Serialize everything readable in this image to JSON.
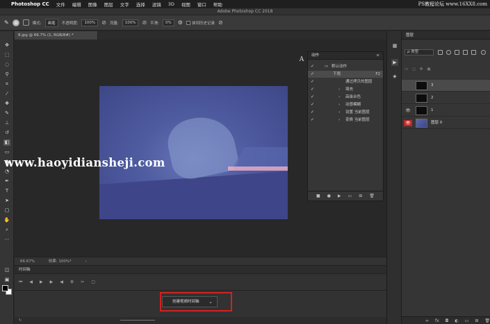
{
  "menubar": {
    "app_name": "Photoshop CC",
    "items": [
      "文件",
      "编辑",
      "图像",
      "图层",
      "文字",
      "选择",
      "滤镜",
      "3D",
      "视图",
      "窗口",
      "帮助"
    ],
    "watermark": "PS教程论坛 www.16XX8.com"
  },
  "window": {
    "title": "Adobe Photoshop CC 2018"
  },
  "options": {
    "mode_label": "模式:",
    "mode_value": "画笔",
    "opacity_label": "不透明度:",
    "opacity_value": "100%",
    "flow_label": "流量:",
    "flow_value": "100%",
    "smoothing_label": "平滑:",
    "smoothing_value": "0%",
    "history_label": "抹到历史记录"
  },
  "document": {
    "tab_label": "8.jpg @ 66.7% (1, RGB/8#) *",
    "zoom": "66.67%",
    "doc_info": "效果: 100%*"
  },
  "actions_panel": {
    "title": "动作",
    "set_name": "默认动作",
    "items": [
      {
        "label": "下雨",
        "key": "F2",
        "selected": true
      },
      {
        "label": "通过拷贝的图层"
      },
      {
        "label": "填充"
      },
      {
        "label": "高级合色"
      },
      {
        "label": "动感模糊"
      },
      {
        "label": "设置 当前图层"
      },
      {
        "label": "变换 当前图层"
      }
    ]
  },
  "timeline": {
    "title": "时间轴",
    "create_button": "创建视频时间轴"
  },
  "layers_panel": {
    "title": "图层",
    "filter_label": "ρ 类型",
    "layers": [
      {
        "name": "3",
        "visible": false,
        "selected": true,
        "thumb": "black"
      },
      {
        "name": "2",
        "visible": false,
        "selected": false,
        "thumb": "black"
      },
      {
        "name": "1",
        "visible": true,
        "selected": false,
        "thumb": "black"
      },
      {
        "name": "图层 0",
        "visible": true,
        "selected": false,
        "thumb": "image",
        "eye_highlight": true
      }
    ]
  },
  "watermark_overlay": "www.haoyidiansheji.com",
  "colors": {
    "accent_red": "#d82020",
    "panel_bg": "#353535",
    "canvas_bg": "#282828"
  }
}
